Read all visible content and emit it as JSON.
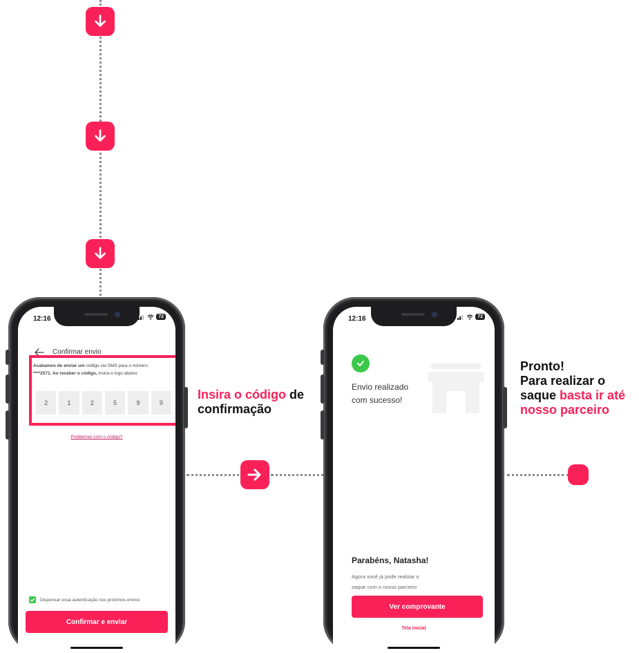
{
  "colors": {
    "accent": "#fa2159",
    "dots": "#8a8a8a",
    "phone_frame": "#1d1d1f"
  },
  "icons": {
    "flow_down": "arrow-down-icon",
    "flow_right": "arrow-right-icon"
  },
  "phone1": {
    "time": "12:16",
    "battery": "72",
    "title": "Confirmar envio",
    "sms_text_bold": "Acabamos de enviar um",
    "sms_text_rest": " código via SMS para o número",
    "sms_number": "****2571.",
    "sms_text2_bold": " Ao receber o código,",
    "sms_text2_rest": " insira-o logo abaixo",
    "digits": [
      "2",
      "1",
      "2",
      "5",
      "9",
      "9"
    ],
    "problems_link": "Problemas com o código?",
    "checkbox_label": "Dispensar essa autenticação nos próximos envios",
    "confirm_button": "Confirmar e enviar"
  },
  "caption_middle": {
    "highlight": "Insira o código",
    "rest1": " de",
    "line2": "confirmação"
  },
  "phone2": {
    "time": "12:16",
    "battery": "72",
    "success_line1": "Envio realizado",
    "success_line2": "com sucesso!",
    "greeting": "Parabéns, Natasha!",
    "subtext_line1": "Agora você já pode realizar o",
    "subtext_line2": "saque com o nosso parceiro",
    "receipt_button": "Ver comprovante",
    "home_link": "Tela inicial"
  },
  "caption_right": {
    "line1": "Pronto!",
    "line2": "Para realizar o",
    "line3_plain": "saque ",
    "line3_highlight": "basta ir até",
    "line4_highlight": "nosso parceiro"
  }
}
